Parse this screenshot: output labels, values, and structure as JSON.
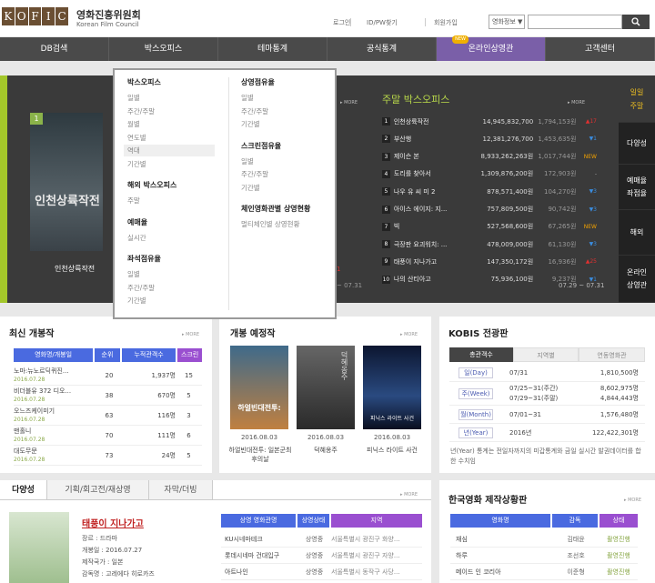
{
  "header": {
    "logo_letters": [
      "K",
      "O",
      "F",
      "I",
      "C"
    ],
    "org_name_ko": "영화진흥위원회",
    "org_name_en": "Korean Film Council",
    "util": [
      "로그인",
      "ID/PW찾기",
      "회원가입"
    ],
    "search_select": "영화정보 ▼",
    "search_placeholder": ""
  },
  "nav": {
    "items": [
      "DB검색",
      "박스오피스",
      "테마통계",
      "공식통계",
      "온라인상영관",
      "고객센터"
    ],
    "new_badge": "NEW"
  },
  "dropdown": {
    "col1": [
      {
        "head": "박스오피스",
        "items": [
          "일별",
          "주간/주말",
          "월별",
          "연도별",
          "역대",
          "기간별"
        ]
      },
      {
        "head": "해외 박스오피스",
        "items": [
          "주말"
        ]
      },
      {
        "head": "예매율",
        "items": [
          "실시간"
        ]
      },
      {
        "head": "좌석점유율",
        "items": [
          "일별",
          "주간/주말",
          "기간별"
        ]
      }
    ],
    "col2": [
      {
        "head": "상영점유율",
        "items": [
          "일별",
          "주간/주말",
          "기간별"
        ]
      },
      {
        "head": "스크린점유율",
        "items": [
          "일별",
          "주간/주말",
          "기간별"
        ]
      },
      {
        "head": "체인영화관별 상영현황",
        "items": [
          "멀티체인별 상영현황"
        ]
      }
    ]
  },
  "weekly": {
    "poster_rank": "1",
    "poster_title_overlay": "인천상륙작전",
    "poster_title": "인천상륙작전",
    "more": "▸ MORE",
    "red_chg": "1",
    "date": "~ 07.31"
  },
  "weekend": {
    "title": "주말 박스오피스",
    "more": "▸ MORE",
    "date": "07.29 ~ 07.31",
    "rows": [
      {
        "rank": "1",
        "name": "인천상륙작전",
        "sales": "14,945,832,700",
        "aud": "1,794,153원",
        "chg": "▲17",
        "chg_color": "#e03030"
      },
      {
        "rank": "2",
        "name": "부산행",
        "sales": "12,381,276,700",
        "aud": "1,453,635원",
        "chg": "▼1",
        "chg_color": "#3a8de0"
      },
      {
        "rank": "3",
        "name": "제이슨 본",
        "sales": "8,933,262,263원",
        "aud": "1,017,744원",
        "chg": "NEW",
        "chg_color": "#f0a000"
      },
      {
        "rank": "4",
        "name": "도리를 찾아서",
        "sales": "1,309,876,200원",
        "aud": "172,903원",
        "chg": "-",
        "chg_color": "#aaa"
      },
      {
        "rank": "5",
        "name": "나우 유 씨 미 2",
        "sales": "878,571,400원",
        "aud": "104,270원",
        "chg": "▼3",
        "chg_color": "#3a8de0"
      },
      {
        "rank": "6",
        "name": "아이스 에이지: 지...",
        "sales": "757,809,500원",
        "aud": "90,742원",
        "chg": "▼3",
        "chg_color": "#3a8de0"
      },
      {
        "rank": "7",
        "name": "빅",
        "sales": "527,568,600원",
        "aud": "67,265원",
        "chg": "NEW",
        "chg_color": "#f0a000"
      },
      {
        "rank": "8",
        "name": "극장판 요괴워치: ...",
        "sales": "478,009,000원",
        "aud": "61,130원",
        "chg": "▼3",
        "chg_color": "#3a8de0"
      },
      {
        "rank": "9",
        "name": "태풍이 지나가고",
        "sales": "147,350,172원",
        "aud": "16,936원",
        "chg": "▲25",
        "chg_color": "#e03030"
      },
      {
        "rank": "10",
        "name": "나의 산티아고",
        "sales": "75,936,100원",
        "aud": "9,237원",
        "chg": "▼1",
        "chg_color": "#3a8de0"
      }
    ]
  },
  "side_tabs": [
    "일일\n주말",
    "다양성",
    "예매율\n좌점율",
    "해외",
    "온라인\n상영관"
  ],
  "new_release": {
    "title": "최신 개봉작",
    "more": "▸ MORE",
    "headers": [
      "영화명/개봉일",
      "순위",
      "누적관객수",
      "스크린"
    ],
    "rows": [
      {
        "name": "노마:뉴노르딕퀴진...",
        "date": "2016.07.28",
        "rank": "20",
        "aud": "1,937명",
        "screen": "15"
      },
      {
        "name": "비더블유 372 디오...",
        "date": "2016.07.28",
        "rank": "38",
        "aud": "670명",
        "screen": "5"
      },
      {
        "name": "오느즈케이미기",
        "date": "2016.07.28",
        "rank": "63",
        "aud": "116명",
        "screen": "3"
      },
      {
        "name": "맨홀니",
        "date": "2016.07.28",
        "rank": "70",
        "aud": "111명",
        "screen": "6"
      },
      {
        "name": "대도무문",
        "date": "2016.07.28",
        "rank": "73",
        "aud": "24명",
        "screen": "5"
      }
    ]
  },
  "upcoming": {
    "title": "개봉 예정작",
    "more": "▸ MORE",
    "items": [
      {
        "date": "2016.08.03",
        "title": "하얼빈대전투: 일본군최후의날",
        "poster_text": "하얼빈대전투:"
      },
      {
        "date": "2016.08.03",
        "title": "덕혜옹주",
        "poster_text": "덕혜옹주"
      },
      {
        "date": "2016.08.03",
        "title": "피닉스 라이트 사건",
        "poster_text": "피닉스 라이트 사건"
      }
    ]
  },
  "kobis": {
    "title": "KOBIS 전광판",
    "tabs": [
      "총관객수",
      "지역별",
      "연동영화관"
    ],
    "rows": [
      {
        "tag": "일(Day)",
        "period": "07/31",
        "value": "1,810,500명"
      },
      {
        "tag": "주(Week)",
        "period": "07/25~31(주간)\n07/29~31(주말)",
        "value": "8,602,975명\n4,844,443명"
      },
      {
        "tag": "월(Month)",
        "period": "07/01~31",
        "value": "1,576,480명"
      },
      {
        "tag": "년(Year)",
        "period": "2016년",
        "value": "122,422,301명"
      }
    ],
    "note": "년(Year) 통계는 전일자까지의 미갑통계와 금일 실시간 발권데이터를 합한 수치임"
  },
  "diversity": {
    "tabs": [
      "다양성",
      "기획/회고전/재상영",
      "자막/더빙"
    ],
    "more": "▸ MORE",
    "film_title": "태풍이 지나가고",
    "info": [
      "장르 : 드라마",
      "개봉일 : 2016.07.27",
      "제작국가 : 일본",
      "감독명 : 고레에다 히로카즈"
    ],
    "table_headers": [
      "상영 영화관명",
      "상영상태",
      "지역"
    ],
    "table_rows": [
      {
        "cinema": "KU시네마테크",
        "status": "상영중",
        "region": "서울특별시 광진구 화양..."
      },
      {
        "cinema": "롯데시네마 건대입구",
        "status": "상영중",
        "region": "서울특별시 광진구 자양..."
      },
      {
        "cinema": "아트나인",
        "status": "상영중",
        "region": "서울특별시 동작구 사당..."
      }
    ]
  },
  "production": {
    "title": "한국영화 제작상황판",
    "more": "▸ MORE",
    "headers": [
      "영화명",
      "감독",
      "상태"
    ],
    "rows": [
      {
        "name": "재심",
        "director": "김태윤",
        "status": "촬영진행"
      },
      {
        "name": "하루",
        "director": "조선호",
        "status": "촬영진행"
      },
      {
        "name": "메이드 인 코리아",
        "director": "이준형",
        "status": "촬영진행"
      }
    ]
  }
}
